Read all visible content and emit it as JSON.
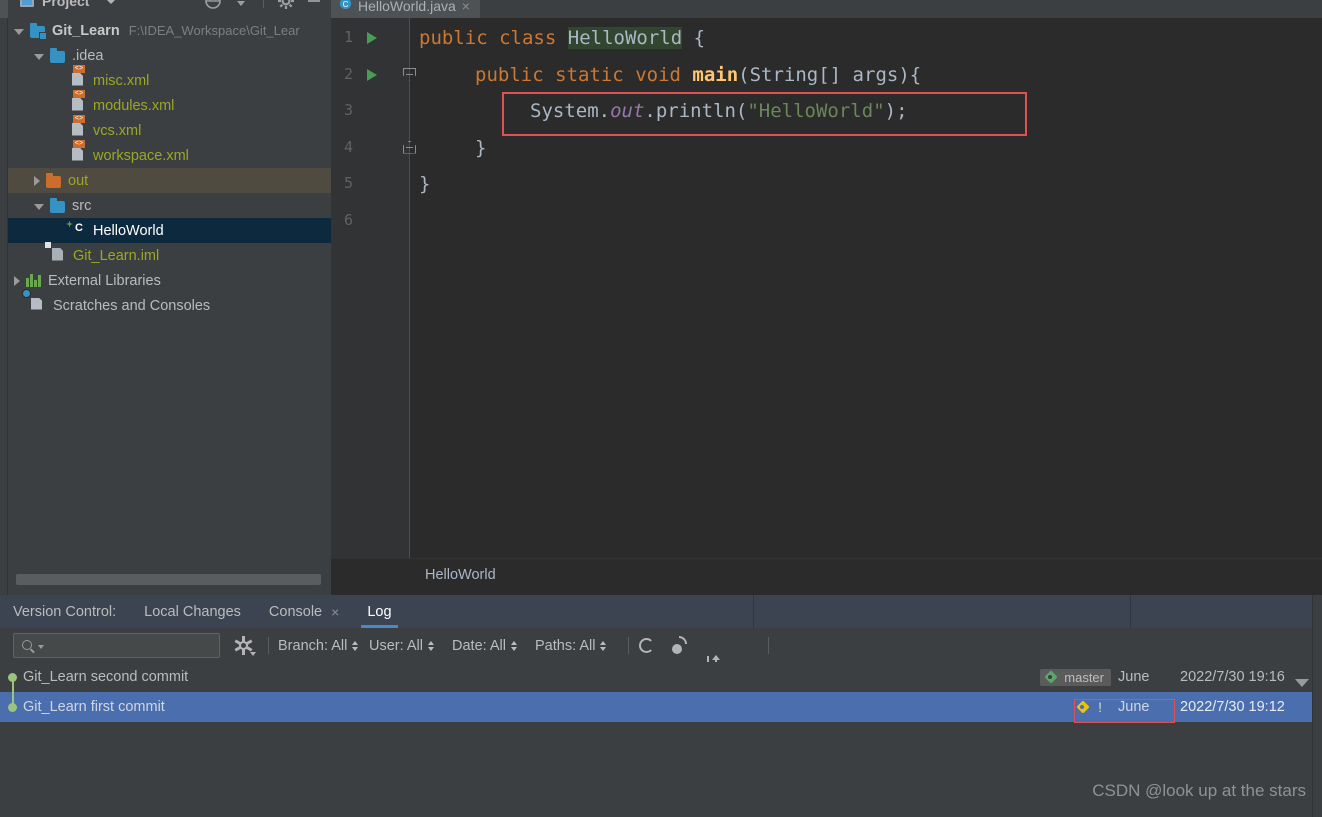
{
  "project_panel": {
    "header": {
      "title": "Project",
      "icons": [
        "locate-icon",
        "collapse-all-icon",
        "gear-icon",
        "minimize-icon"
      ]
    },
    "tree": [
      {
        "label": "Git_Learn",
        "path": "F:\\IDEA_Workspace\\Git_Lear",
        "icon": "module-folder-icon",
        "arrow": "down",
        "indent": 0,
        "state": "normal",
        "bold": true,
        "color": "#c8c8c8"
      },
      {
        "label": ".idea",
        "path": "",
        "icon": "folder-blue-icon",
        "arrow": "down",
        "indent": 1,
        "state": "normal",
        "bold": false,
        "color": "#bbbbbb"
      },
      {
        "label": "misc.xml",
        "path": "",
        "icon": "xml-file-icon",
        "arrow": "none",
        "indent": 2,
        "state": "normal",
        "bold": false,
        "color": "#9aa824"
      },
      {
        "label": "modules.xml",
        "path": "",
        "icon": "xml-file-icon",
        "arrow": "none",
        "indent": 2,
        "state": "normal",
        "bold": false,
        "color": "#9aa824"
      },
      {
        "label": "vcs.xml",
        "path": "",
        "icon": "xml-file-icon",
        "arrow": "none",
        "indent": 2,
        "state": "normal",
        "bold": false,
        "color": "#9aa824"
      },
      {
        "label": "workspace.xml",
        "path": "",
        "icon": "xml-file-icon",
        "arrow": "none",
        "indent": 2,
        "state": "normal",
        "bold": false,
        "color": "#9aa824"
      },
      {
        "label": "out",
        "path": "",
        "icon": "folder-orange-icon",
        "arrow": "right",
        "indent": 1,
        "state": "highlighted",
        "bold": false,
        "color": "#9aa824"
      },
      {
        "label": "src",
        "path": "",
        "icon": "folder-blue-icon",
        "arrow": "down",
        "indent": 1,
        "state": "normal",
        "bold": false,
        "color": "#bbbbbb"
      },
      {
        "label": "HelloWorld",
        "path": "",
        "icon": "java-class-icon",
        "arrow": "none",
        "indent": 2,
        "state": "selected",
        "bold": false,
        "color": "#ffffff"
      },
      {
        "label": "Git_Learn.iml",
        "path": "",
        "icon": "iml-file-icon",
        "arrow": "none",
        "indent": 1,
        "state": "normal",
        "bold": false,
        "color": "#9aa824"
      },
      {
        "label": "External Libraries",
        "path": "",
        "icon": "libraries-icon",
        "arrow": "right",
        "indent": 0,
        "state": "normal",
        "bold": false,
        "color": "#bbbbbb"
      },
      {
        "label": "Scratches and Consoles",
        "path": "",
        "icon": "scratches-icon",
        "arrow": "none",
        "indent": 0,
        "state": "normal",
        "bold": false,
        "color": "#bbbbbb"
      }
    ]
  },
  "editor": {
    "tab": {
      "label": "HelloWorld.java",
      "close": "×",
      "icon": "java-class-icon"
    },
    "lines": [
      {
        "n": "1",
        "run": true,
        "fold": "none"
      },
      {
        "n": "2",
        "run": true,
        "fold": "open"
      },
      {
        "n": "3",
        "run": false,
        "fold": "none"
      },
      {
        "n": "4",
        "run": false,
        "fold": "close"
      },
      {
        "n": "5",
        "run": false,
        "fold": "none"
      },
      {
        "n": "6",
        "run": false,
        "fold": "none"
      }
    ],
    "code": {
      "l1_kw1": "public",
      "l1_kw2": "class",
      "l1_name": "HelloWorld",
      "l1_brace": "{",
      "l2_kw1": "public",
      "l2_kw2": "static",
      "l2_kw3": "void",
      "l2_method": "main",
      "l2_args": "(String[] args){",
      "l3_sys": "System.",
      "l3_out": "out",
      "l3_println": ".println(",
      "l3_str": "\"HelloWorld\"",
      "l3_tail": ");",
      "l4_brace": "}",
      "l5_brace": "}"
    },
    "breadcrumb": "HelloWorld"
  },
  "version_control": {
    "title": "Version Control:",
    "tabs": [
      {
        "label": "Local Changes",
        "active": false,
        "closable": false
      },
      {
        "label": "Console",
        "active": false,
        "closable": true
      },
      {
        "label": "Log",
        "active": true,
        "closable": false
      }
    ],
    "toolbar": {
      "search_placeholder": "",
      "search_icon": "search-icon",
      "gear_icon": "gear-icon",
      "filters": [
        {
          "label": "Branch: All"
        },
        {
          "label": "User: All"
        },
        {
          "label": "Date: All"
        },
        {
          "label": "Paths: All"
        }
      ],
      "actions": [
        "refresh-icon",
        "cherry-pick-icon",
        "sort-icon",
        "eye-icon",
        "add-tab-icon"
      ],
      "right_search_icon": "search-icon"
    },
    "commits": [
      {
        "subject": "Git_Learn second commit",
        "refs": [
          {
            "name": "master",
            "type": "branch",
            "icon": "tag-green-icon",
            "boxed": false
          }
        ],
        "author": "June",
        "date": "2022/7/30 19:16",
        "selected": false
      },
      {
        "subject": "Git_Learn first commit",
        "refs": [
          {
            "name": "June",
            "type": "tag",
            "icon": "tag-yellow-icon",
            "boxed": true,
            "marker": "!"
          }
        ],
        "author": "",
        "date": "2022/7/30 19:12",
        "selected": true
      }
    ]
  },
  "watermark": "CSDN @look up at the stars"
}
